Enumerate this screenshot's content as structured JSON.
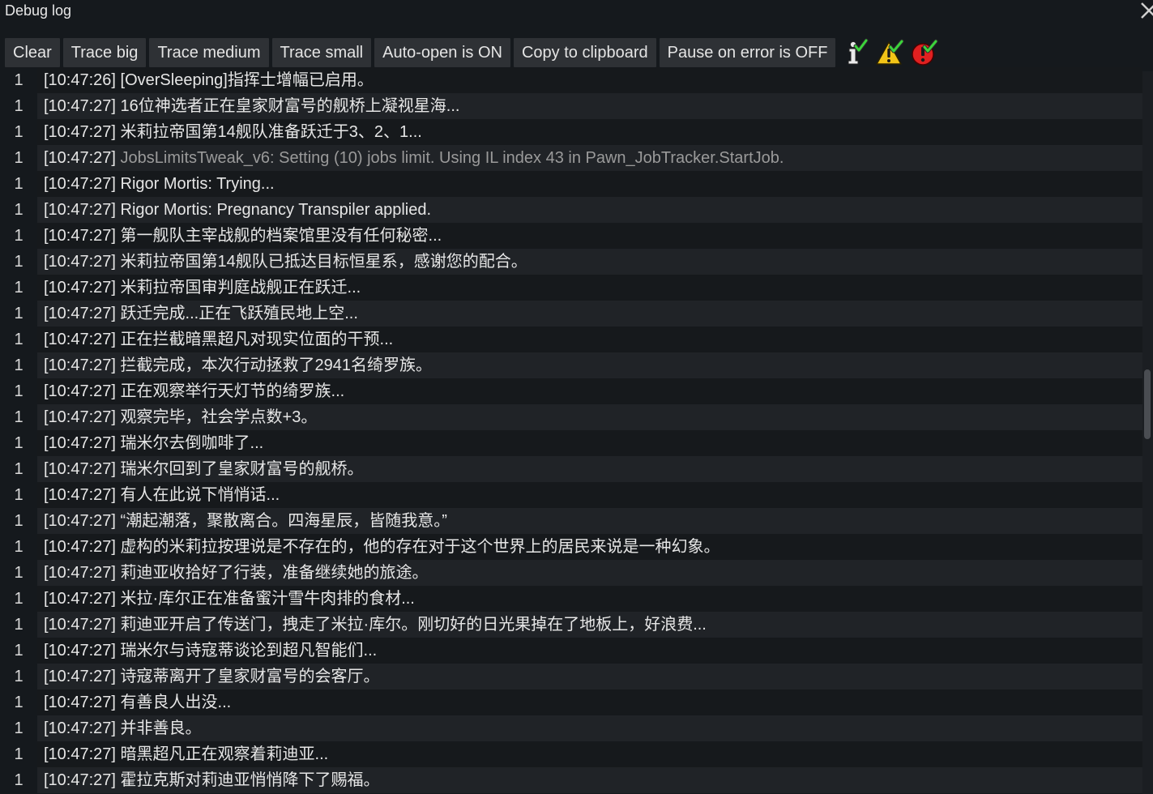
{
  "window": {
    "title": "Debug log"
  },
  "toolbar": {
    "buttons": [
      {
        "label": "Clear"
      },
      {
        "label": "Trace big"
      },
      {
        "label": "Trace medium"
      },
      {
        "label": "Trace small"
      },
      {
        "label": "Auto-open is ON"
      },
      {
        "label": "Copy to clipboard"
      },
      {
        "label": "Pause on error is OFF"
      }
    ],
    "icons": [
      "info-filter-icon",
      "warning-filter-icon",
      "error-filter-icon"
    ],
    "colors": {
      "check": "#3cd43c",
      "warning": "#f2c417",
      "error": "#e02020"
    }
  },
  "log": {
    "rows": [
      {
        "count": "1",
        "time": "[10:47:26]",
        "text": "[OverSleeping]指挥士增幅已启用。"
      },
      {
        "count": "1",
        "time": "[10:47:27]",
        "text": "16位神选者正在皇家财富号的舰桥上凝视星海..."
      },
      {
        "count": "1",
        "time": "[10:47:27]",
        "text": "米莉拉帝国第14舰队准备跃迁于3、2、1..."
      },
      {
        "count": "1",
        "time": "[10:47:27]",
        "text": "JobsLimitsTweak_v6: Setting (10) jobs limit. Using IL index 43 in Pawn_JobTracker.StartJob.",
        "dim": true
      },
      {
        "count": "1",
        "time": "[10:47:27]",
        "text": "Rigor Mortis: Trying..."
      },
      {
        "count": "1",
        "time": "[10:47:27]",
        "text": "Rigor Mortis: Pregnancy Transpiler applied."
      },
      {
        "count": "1",
        "time": "[10:47:27]",
        "text": "第一舰队主宰战舰的档案馆里没有任何秘密..."
      },
      {
        "count": "1",
        "time": "[10:47:27]",
        "text": "米莉拉帝国第14舰队已抵达目标恒星系，感谢您的配合。"
      },
      {
        "count": "1",
        "time": "[10:47:27]",
        "text": "米莉拉帝国审判庭战舰正在跃迁..."
      },
      {
        "count": "1",
        "time": "[10:47:27]",
        "text": "跃迁完成...正在飞跃殖民地上空..."
      },
      {
        "count": "1",
        "time": "[10:47:27]",
        "text": "正在拦截暗黑超凡对现实位面的干预..."
      },
      {
        "count": "1",
        "time": "[10:47:27]",
        "text": "拦截完成，本次行动拯救了2941名绮罗族。"
      },
      {
        "count": "1",
        "time": "[10:47:27]",
        "text": "正在观察举行天灯节的绮罗族..."
      },
      {
        "count": "1",
        "time": "[10:47:27]",
        "text": "观察完毕，社会学点数+3。"
      },
      {
        "count": "1",
        "time": "[10:47:27]",
        "text": "瑞米尔去倒咖啡了..."
      },
      {
        "count": "1",
        "time": "[10:47:27]",
        "text": "瑞米尔回到了皇家财富号的舰桥。"
      },
      {
        "count": "1",
        "time": "[10:47:27]",
        "text": "有人在此说下悄悄话..."
      },
      {
        "count": "1",
        "time": "[10:47:27]",
        "text": "“潮起潮落，聚散离合。四海星辰，皆随我意。”"
      },
      {
        "count": "1",
        "time": "[10:47:27]",
        "text": "虚构的米莉拉按理说是不存在的，他的存在对于这个世界上的居民来说是一种幻象。"
      },
      {
        "count": "1",
        "time": "[10:47:27]",
        "text": "莉迪亚收拾好了行装，准备继续她的旅途。"
      },
      {
        "count": "1",
        "time": "[10:47:27]",
        "text": "米拉·库尔正在准备蜜汁雪牛肉排的食材..."
      },
      {
        "count": "1",
        "time": "[10:47:27]",
        "text": "莉迪亚开启了传送门，拽走了米拉·库尔。刚切好的日光果掉在了地板上，好浪费..."
      },
      {
        "count": "1",
        "time": "[10:47:27]",
        "text": "瑞米尔与诗寇蒂谈论到超凡智能们..."
      },
      {
        "count": "1",
        "time": "[10:47:27]",
        "text": "诗寇蒂离开了皇家财富号的会客厅。"
      },
      {
        "count": "1",
        "time": "[10:47:27]",
        "text": "有善良人出没..."
      },
      {
        "count": "1",
        "time": "[10:47:27]",
        "text": "并非善良。"
      },
      {
        "count": "1",
        "time": "[10:47:27]",
        "text": "暗黑超凡正在观察着莉迪亚..."
      },
      {
        "count": "1",
        "time": "[10:47:27]",
        "text": "霍拉克斯对莉迪亚悄悄降下了赐福。"
      }
    ]
  }
}
